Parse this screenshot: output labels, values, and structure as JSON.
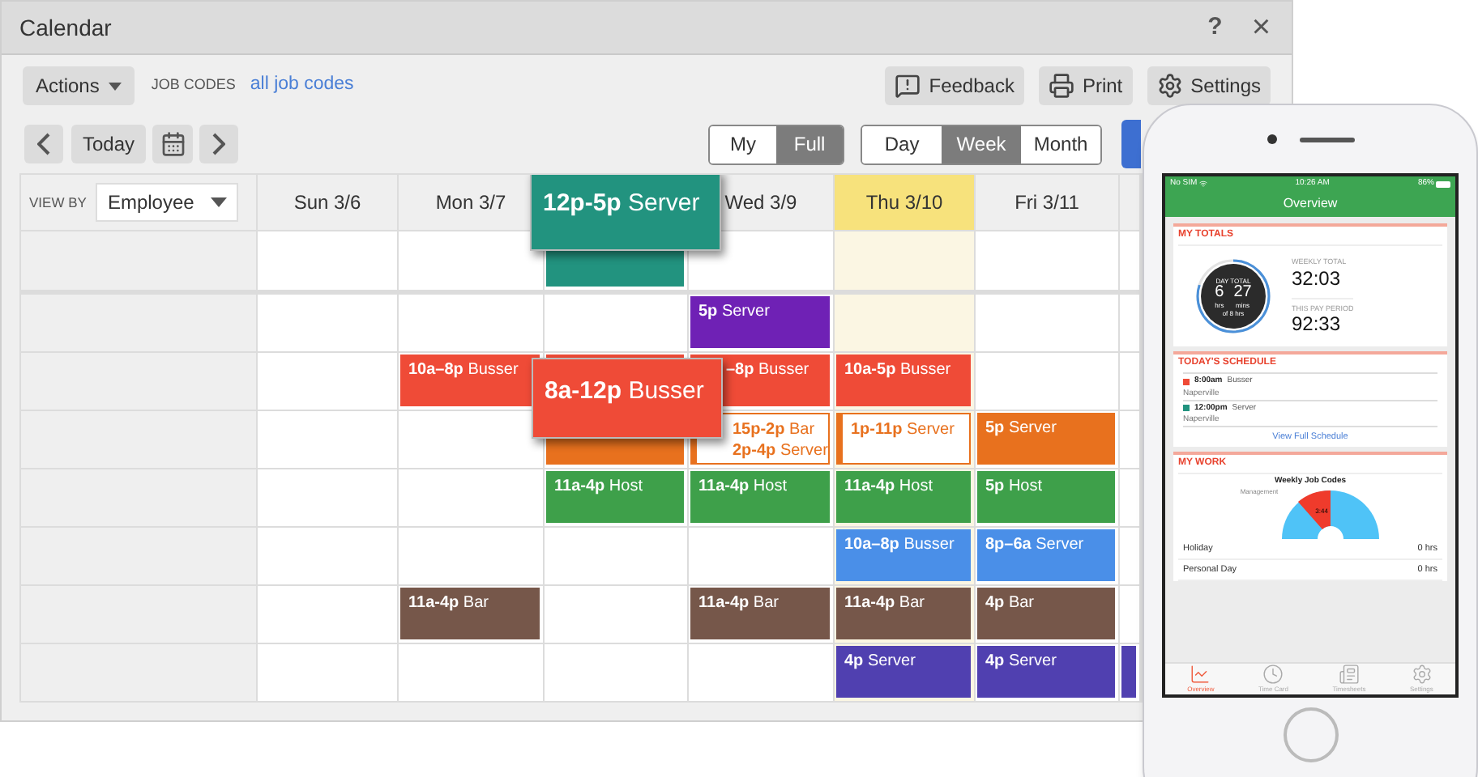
{
  "window": {
    "title": "Calendar",
    "help": "?",
    "close": "×"
  },
  "toolbar": {
    "actions": "Actions",
    "job_codes_label": "JOB CODES",
    "job_codes_link": "all job codes",
    "buttons": [
      {
        "kind": "feedback",
        "label": "Feedback"
      },
      {
        "kind": "print",
        "label": "Print"
      },
      {
        "kind": "settings",
        "label": "Settings"
      }
    ]
  },
  "nav": {
    "today": "Today",
    "scope": [
      {
        "label": "My",
        "selected": false
      },
      {
        "label": "Full",
        "selected": true
      }
    ],
    "views": [
      {
        "label": "Day",
        "selected": false
      },
      {
        "label": "Week",
        "selected": true
      },
      {
        "label": "Month",
        "selected": false
      }
    ]
  },
  "grid": {
    "view_by_label": "VIEW BY",
    "view_by": "Employee",
    "days": [
      {
        "label": "Sun 3/6",
        "today": false
      },
      {
        "label": "Mon 3/7",
        "today": false
      },
      {
        "popup": {
          "color": "#22937f",
          "time": "12p-5p",
          "role": "Server"
        }
      },
      {
        "label": "Wed 3/9",
        "today": false
      },
      {
        "label": "Thu 3/10",
        "today": true
      },
      {
        "label": "Fri 3/11",
        "today": false
      },
      {
        "today": false
      }
    ],
    "rows": [
      {
        "cells": [
          {},
          {},
          {
            "shift": {
              "kind": "solid",
              "color": "#22937f"
            }
          },
          {},
          {},
          {},
          {}
        ]
      },
      {
        "cells": [
          {},
          {},
          {},
          {
            "shift": {
              "kind": "solid",
              "color": "#6f21b5",
              "lines": [
                {
                  "time": "5p",
                  "role": "Server"
                }
              ]
            }
          },
          {},
          {},
          {}
        ]
      },
      {
        "cells": [
          {},
          {
            "shift": {
              "kind": "solid",
              "color": "#ef4b37",
              "lines": [
                {
                  "time": "10a–8p",
                  "role": "Busser"
                }
              ]
            }
          },
          {
            "shift": {
              "kind": "solid",
              "color": "#ef4b37"
            }
          },
          {
            "shift": {
              "kind": "solid",
              "color": "#ef4b37",
              "covered": true,
              "lines": [
                {
                  "time": "–8p",
                  "role": "Busser"
                }
              ]
            }
          },
          {
            "shift": {
              "kind": "solid",
              "color": "#ef4b37",
              "lines": [
                {
                  "time": "10a-5p",
                  "role": "Busser"
                }
              ]
            }
          },
          {},
          {}
        ]
      },
      {
        "cells": [
          {},
          {},
          {
            "shift": {
              "kind": "solid",
              "color": "#e8711e"
            }
          },
          {
            "shift": {
              "kind": "outline",
              "color": "#e8711e",
              "covered": true,
              "lines": [
                {
                  "time": "15p-2p",
                  "role": "Bar"
                },
                {
                  "time": "2p-4p",
                  "role": "Server"
                }
              ]
            }
          },
          {
            "shift": {
              "kind": "outline",
              "color": "#e8711e",
              "lines": [
                {
                  "time": "1p-11p",
                  "role": "Server"
                }
              ]
            }
          },
          {
            "shift": {
              "kind": "solid",
              "color": "#e8711e",
              "lines": [
                {
                  "time": "5p",
                  "role": "Server"
                }
              ]
            }
          },
          {}
        ]
      },
      {
        "cells": [
          {},
          {},
          {
            "shift": {
              "kind": "solid",
              "color": "#3ea04a",
              "lines": [
                {
                  "time": "11a-4p",
                  "role": "Host"
                }
              ]
            }
          },
          {
            "shift": {
              "kind": "solid",
              "color": "#3ea04a",
              "lines": [
                {
                  "time": "11a-4p",
                  "role": "Host"
                }
              ]
            }
          },
          {
            "shift": {
              "kind": "solid",
              "color": "#3ea04a",
              "lines": [
                {
                  "time": "11a-4p",
                  "role": "Host"
                }
              ]
            }
          },
          {
            "shift": {
              "kind": "solid",
              "color": "#3ea04a",
              "lines": [
                {
                  "time": "5p",
                  "role": "Host"
                }
              ]
            }
          },
          {}
        ]
      },
      {
        "cells": [
          {},
          {},
          {},
          {},
          {
            "shift": {
              "kind": "solid",
              "color": "#4a8fe8",
              "lines": [
                {
                  "time": "10a–8p",
                  "role": "Busser"
                }
              ]
            }
          },
          {
            "shift": {
              "kind": "solid",
              "color": "#4a8fe8",
              "lines": [
                {
                  "time": "8p–6a",
                  "role": "Server"
                }
              ]
            }
          },
          {}
        ]
      },
      {
        "cells": [
          {},
          {
            "shift": {
              "kind": "solid",
              "color": "#76574a",
              "lines": [
                {
                  "time": "11a-4p",
                  "role": "Bar"
                }
              ]
            }
          },
          {},
          {
            "shift": {
              "kind": "solid",
              "color": "#76574a",
              "lines": [
                {
                  "time": "11a-4p",
                  "role": "Bar"
                }
              ]
            }
          },
          {
            "shift": {
              "kind": "solid",
              "color": "#76574a",
              "lines": [
                {
                  "time": "11a-4p",
                  "role": "Bar"
                }
              ]
            }
          },
          {
            "shift": {
              "kind": "solid",
              "color": "#76574a",
              "lines": [
                {
                  "time": "4p",
                  "role": "Bar"
                }
              ]
            }
          },
          {}
        ]
      },
      {
        "cells": [
          {},
          {},
          {},
          {},
          {
            "shift": {
              "kind": "solid",
              "color": "#5040b0",
              "lines": [
                {
                  "time": "4p",
                  "role": "Server"
                }
              ]
            }
          },
          {
            "shift": {
              "kind": "solid",
              "color": "#5040b0",
              "lines": [
                {
                  "time": "4p",
                  "role": "Server"
                }
              ]
            }
          },
          {
            "shift": {
              "kind": "solid",
              "color": "#5040b0"
            }
          }
        ]
      }
    ]
  },
  "popups": [
    {
      "color": "#ef4b37",
      "time": "8a-12p",
      "role": "Busser"
    }
  ],
  "phone": {
    "carrier": "No SIM",
    "clock": "10:26 AM",
    "battery": "86%",
    "title": "Overview",
    "totals": {
      "heading": "MY TOTALS",
      "ring_label": "DAY TOTAL",
      "hours": "6",
      "hours_unit": "hrs",
      "minutes": "27",
      "minutes_unit": "mins",
      "of": "of 8 hrs",
      "weekly_label": "WEEKLY TOTAL",
      "weekly": "32:03",
      "period_label": "THIS PAY PERIOD",
      "period": "92:33"
    },
    "schedule": {
      "heading": "TODAY'S SCHEDULE",
      "items": [
        {
          "time": "8:00am",
          "role": "Busser",
          "place": "Naperville",
          "color": "#ef4b37"
        },
        {
          "time": "12:00pm",
          "role": "Server",
          "place": "Naperville",
          "color": "#22937f"
        }
      ],
      "link": "View Full Schedule"
    },
    "work": {
      "heading": "MY WORK",
      "chart_title": "Weekly Job Codes",
      "slice_label": "Management",
      "slice_value": "3:44",
      "rows": [
        {
          "label": "Holiday",
          "value": "0 hrs"
        },
        {
          "label": "Personal Day",
          "value": "0 hrs"
        }
      ]
    },
    "tabs": [
      {
        "kind": "overview",
        "label": "Overview",
        "selected": true
      },
      {
        "kind": "timecard",
        "label": "Time Card",
        "selected": false
      },
      {
        "kind": "timesheets",
        "label": "Timesheets",
        "selected": false
      },
      {
        "kind": "settings",
        "label": "Settings",
        "selected": false
      }
    ]
  }
}
